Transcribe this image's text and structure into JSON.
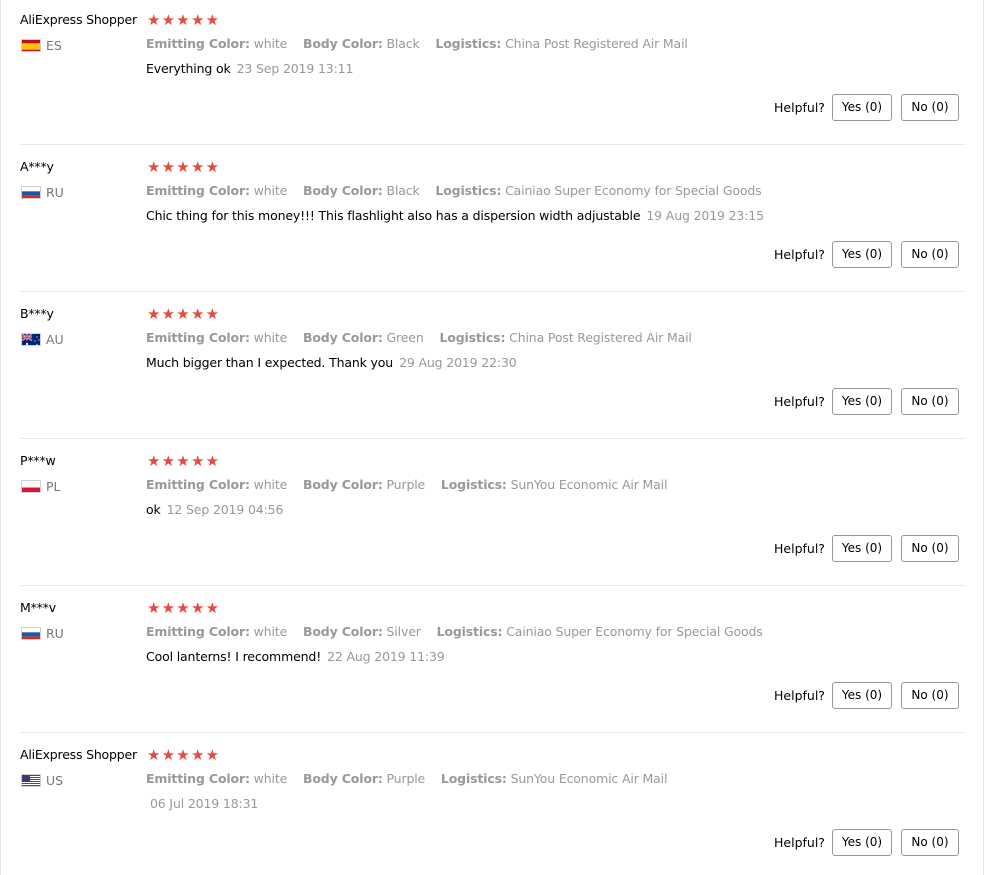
{
  "reviews": [
    {
      "user": "AliExpress Shopper",
      "country": "ES",
      "flag_icon": "spain-flag-icon",
      "stars": "★★★★★",
      "rating": 5,
      "emitting_label": "Emitting Color:",
      "emitting_value": "white",
      "body_label": "Body Color:",
      "body_value": "Black",
      "logistics_label": "Logistics:",
      "logistics_value": "China Post Registered Air Mail",
      "text": "Everything ok",
      "date": "23 Sep 2019 13:11",
      "helpful_label": "Helpful?",
      "yes_label": "Yes (0)",
      "no_label": "No (0)"
    },
    {
      "user": "A***y",
      "country": "RU",
      "flag_icon": "russia-flag-icon",
      "stars": "★★★★★",
      "rating": 5,
      "emitting_label": "Emitting Color:",
      "emitting_value": "white",
      "body_label": "Body Color:",
      "body_value": "Black",
      "logistics_label": "Logistics:",
      "logistics_value": "Cainiao Super Economy for Special Goods",
      "text": "Chic thing for this money!!! This flashlight also has a dispersion width adjustable",
      "date": "19 Aug 2019 23:15",
      "helpful_label": "Helpful?",
      "yes_label": "Yes (0)",
      "no_label": "No (0)"
    },
    {
      "user": "B***y",
      "country": "AU",
      "flag_icon": "australia-flag-icon",
      "stars": "★★★★★",
      "rating": 5,
      "emitting_label": "Emitting Color:",
      "emitting_value": "white",
      "body_label": "Body Color:",
      "body_value": "Green",
      "logistics_label": "Logistics:",
      "logistics_value": "China Post Registered Air Mail",
      "text": "Much bigger than I expected. Thank you",
      "date": "29 Aug 2019 22:30",
      "helpful_label": "Helpful?",
      "yes_label": "Yes (0)",
      "no_label": "No (0)"
    },
    {
      "user": "P***w",
      "country": "PL",
      "flag_icon": "poland-flag-icon",
      "stars": "★★★★★",
      "rating": 5,
      "emitting_label": "Emitting Color:",
      "emitting_value": "white",
      "body_label": "Body Color:",
      "body_value": "Purple",
      "logistics_label": "Logistics:",
      "logistics_value": "SunYou Economic Air Mail",
      "text": "ok",
      "date": "12 Sep 2019 04:56",
      "helpful_label": "Helpful?",
      "yes_label": "Yes (0)",
      "no_label": "No (0)"
    },
    {
      "user": "M***v",
      "country": "RU",
      "flag_icon": "russia-flag-icon",
      "stars": "★★★★★",
      "rating": 5,
      "emitting_label": "Emitting Color:",
      "emitting_value": "white",
      "body_label": "Body Color:",
      "body_value": "Silver",
      "logistics_label": "Logistics:",
      "logistics_value": "Cainiao Super Economy for Special Goods",
      "text": "Cool lanterns! I recommend!",
      "date": "22 Aug 2019 11:39",
      "helpful_label": "Helpful?",
      "yes_label": "Yes (0)",
      "no_label": "No (0)"
    },
    {
      "user": "AliExpress Shopper",
      "country": "US",
      "flag_icon": "usa-flag-icon",
      "stars": "★★★★★",
      "rating": 5,
      "emitting_label": "Emitting Color:",
      "emitting_value": "white",
      "body_label": "Body Color:",
      "body_value": "Purple",
      "logistics_label": "Logistics:",
      "logistics_value": "SunYou Economic Air Mail",
      "text": "",
      "date": "06 Jul 2019 18:31",
      "helpful_label": "Helpful?",
      "yes_label": "Yes (0)",
      "no_label": "No (0)"
    }
  ],
  "colors": {
    "star": "#e84a3f",
    "muted_text": "#999999",
    "divider": "#e6e6e6",
    "button_border": "#999999"
  }
}
